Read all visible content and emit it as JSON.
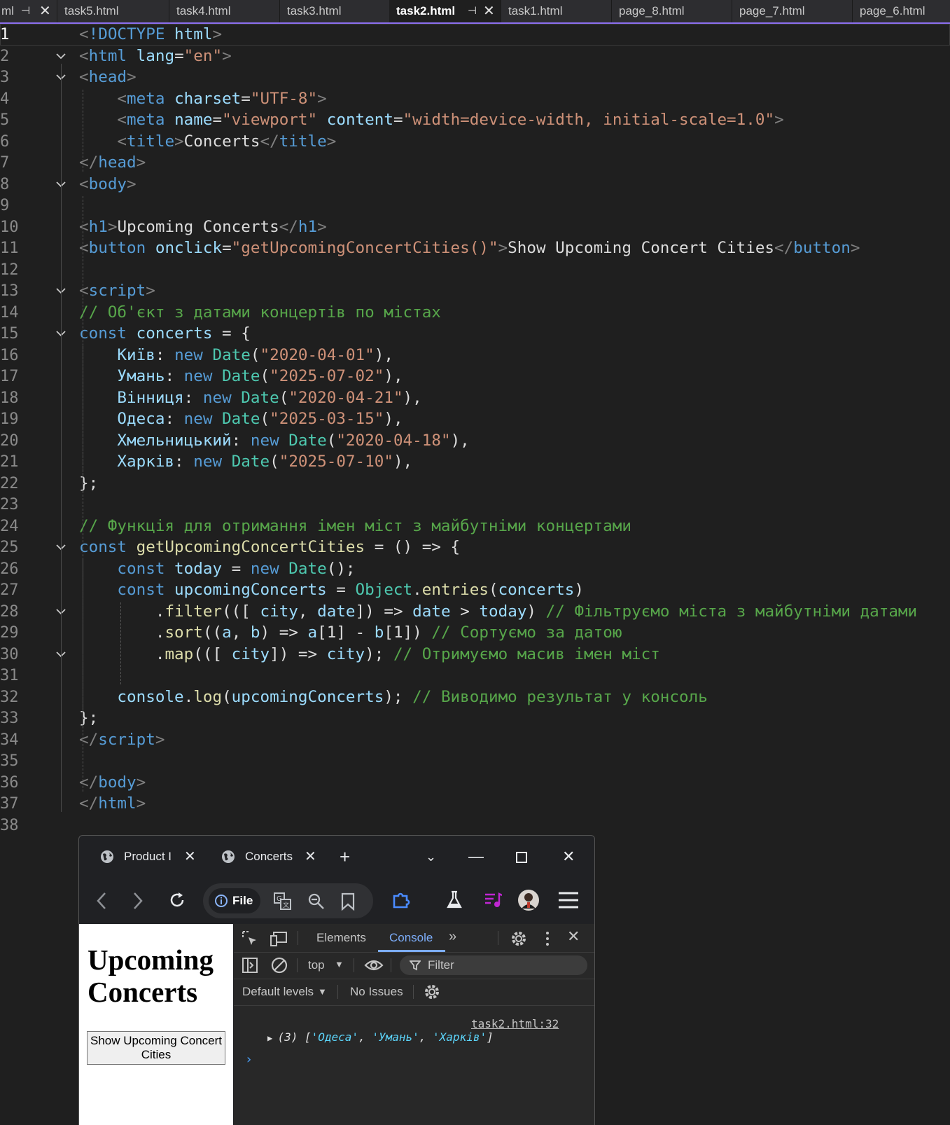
{
  "editor": {
    "tabs": [
      {
        "label": "ml",
        "active": false
      },
      {
        "label": "task5.html",
        "active": false
      },
      {
        "label": "task4.html",
        "active": false
      },
      {
        "label": "task3.html",
        "active": false
      },
      {
        "label": "task2.html",
        "active": true
      },
      {
        "label": "task1.html",
        "active": false
      },
      {
        "label": "page_8.html",
        "active": false
      },
      {
        "label": "page_7.html",
        "active": false
      },
      {
        "label": "page_6.html",
        "active": false
      }
    ],
    "lines": [
      {
        "n": "1",
        "tokens": [
          [
            "c-punc",
            "<"
          ],
          [
            "c-tag",
            "!DOCTYPE"
          ],
          [
            "c-txt",
            " "
          ],
          [
            "c-attr",
            "html"
          ],
          [
            "c-punc",
            ">"
          ]
        ]
      },
      {
        "n": "2",
        "tokens": [
          [
            "c-punc",
            "<"
          ],
          [
            "c-tag",
            "html"
          ],
          [
            "c-txt",
            " "
          ],
          [
            "c-attr",
            "lang"
          ],
          [
            "c-txt",
            "="
          ],
          [
            "c-str",
            "\"en\""
          ],
          [
            "c-punc",
            ">"
          ]
        ]
      },
      {
        "n": "3",
        "tokens": [
          [
            "c-punc",
            "<"
          ],
          [
            "c-tag",
            "head"
          ],
          [
            "c-punc",
            ">"
          ]
        ]
      },
      {
        "n": "4",
        "tokens": [
          [
            "c-txt",
            "    "
          ],
          [
            "c-punc",
            "<"
          ],
          [
            "c-tag",
            "meta"
          ],
          [
            "c-txt",
            " "
          ],
          [
            "c-attr",
            "charset"
          ],
          [
            "c-txt",
            "="
          ],
          [
            "c-str",
            "\"UTF-8\""
          ],
          [
            "c-punc",
            ">"
          ]
        ]
      },
      {
        "n": "5",
        "tokens": [
          [
            "c-txt",
            "    "
          ],
          [
            "c-punc",
            "<"
          ],
          [
            "c-tag",
            "meta"
          ],
          [
            "c-txt",
            " "
          ],
          [
            "c-attr",
            "name"
          ],
          [
            "c-txt",
            "="
          ],
          [
            "c-str",
            "\"viewport\""
          ],
          [
            "c-txt",
            " "
          ],
          [
            "c-attr",
            "content"
          ],
          [
            "c-txt",
            "="
          ],
          [
            "c-str",
            "\"width=device-width, initial-scale=1.0\""
          ],
          [
            "c-punc",
            ">"
          ]
        ]
      },
      {
        "n": "6",
        "tokens": [
          [
            "c-txt",
            "    "
          ],
          [
            "c-punc",
            "<"
          ],
          [
            "c-tag",
            "title"
          ],
          [
            "c-punc",
            ">"
          ],
          [
            "c-txt",
            "Concerts"
          ],
          [
            "c-punc",
            "</"
          ],
          [
            "c-tag",
            "title"
          ],
          [
            "c-punc",
            ">"
          ]
        ]
      },
      {
        "n": "7",
        "tokens": [
          [
            "c-punc",
            "</"
          ],
          [
            "c-tag",
            "head"
          ],
          [
            "c-punc",
            ">"
          ]
        ]
      },
      {
        "n": "8",
        "tokens": [
          [
            "c-punc",
            "<"
          ],
          [
            "c-tag",
            "body"
          ],
          [
            "c-punc",
            ">"
          ]
        ]
      },
      {
        "n": "9",
        "tokens": []
      },
      {
        "n": "10",
        "tokens": [
          [
            "c-punc",
            "<"
          ],
          [
            "c-tag",
            "h1"
          ],
          [
            "c-punc",
            ">"
          ],
          [
            "c-txt",
            "Upcoming Concerts"
          ],
          [
            "c-punc",
            "</"
          ],
          [
            "c-tag",
            "h1"
          ],
          [
            "c-punc",
            ">"
          ]
        ]
      },
      {
        "n": "11",
        "tokens": [
          [
            "c-punc",
            "<"
          ],
          [
            "c-tag",
            "button"
          ],
          [
            "c-txt",
            " "
          ],
          [
            "c-attr",
            "onclick"
          ],
          [
            "c-txt",
            "="
          ],
          [
            "c-str",
            "\"getUpcomingConcertCities()\""
          ],
          [
            "c-punc",
            ">"
          ],
          [
            "c-txt",
            "Show Upcoming Concert Cities"
          ],
          [
            "c-punc",
            "</"
          ],
          [
            "c-tag",
            "button"
          ],
          [
            "c-punc",
            ">"
          ]
        ]
      },
      {
        "n": "12",
        "tokens": []
      },
      {
        "n": "13",
        "tokens": [
          [
            "c-punc",
            "<"
          ],
          [
            "c-tag",
            "script"
          ],
          [
            "c-punc",
            ">"
          ]
        ]
      },
      {
        "n": "14",
        "tokens": [
          [
            "c-com",
            "// Об'єкт з датами концертів по містах"
          ]
        ]
      },
      {
        "n": "15",
        "tokens": [
          [
            "c-kw",
            "const"
          ],
          [
            "c-txt",
            " "
          ],
          [
            "c-var",
            "concerts"
          ],
          [
            "c-txt",
            " = {"
          ]
        ]
      },
      {
        "n": "16",
        "tokens": [
          [
            "c-txt",
            "    "
          ],
          [
            "c-var",
            "Київ"
          ],
          [
            "c-txt",
            ": "
          ],
          [
            "c-kw",
            "new"
          ],
          [
            "c-txt",
            " "
          ],
          [
            "c-type",
            "Date"
          ],
          [
            "c-txt",
            "("
          ],
          [
            "c-str",
            "\"2020-04-01\""
          ],
          [
            "c-txt",
            "),"
          ]
        ]
      },
      {
        "n": "17",
        "tokens": [
          [
            "c-txt",
            "    "
          ],
          [
            "c-var",
            "Умань"
          ],
          [
            "c-txt",
            ": "
          ],
          [
            "c-kw",
            "new"
          ],
          [
            "c-txt",
            " "
          ],
          [
            "c-type",
            "Date"
          ],
          [
            "c-txt",
            "("
          ],
          [
            "c-str",
            "\"2025-07-02\""
          ],
          [
            "c-txt",
            "),"
          ]
        ]
      },
      {
        "n": "18",
        "tokens": [
          [
            "c-txt",
            "    "
          ],
          [
            "c-var",
            "Вінниця"
          ],
          [
            "c-txt",
            ": "
          ],
          [
            "c-kw",
            "new"
          ],
          [
            "c-txt",
            " "
          ],
          [
            "c-type",
            "Date"
          ],
          [
            "c-txt",
            "("
          ],
          [
            "c-str",
            "\"2020-04-21\""
          ],
          [
            "c-txt",
            "),"
          ]
        ]
      },
      {
        "n": "19",
        "tokens": [
          [
            "c-txt",
            "    "
          ],
          [
            "c-var",
            "Одеса"
          ],
          [
            "c-txt",
            ": "
          ],
          [
            "c-kw",
            "new"
          ],
          [
            "c-txt",
            " "
          ],
          [
            "c-type",
            "Date"
          ],
          [
            "c-txt",
            "("
          ],
          [
            "c-str",
            "\"2025-03-15\""
          ],
          [
            "c-txt",
            "),"
          ]
        ]
      },
      {
        "n": "20",
        "tokens": [
          [
            "c-txt",
            "    "
          ],
          [
            "c-var",
            "Хмельницький"
          ],
          [
            "c-txt",
            ": "
          ],
          [
            "c-kw",
            "new"
          ],
          [
            "c-txt",
            " "
          ],
          [
            "c-type",
            "Date"
          ],
          [
            "c-txt",
            "("
          ],
          [
            "c-str",
            "\"2020-04-18\""
          ],
          [
            "c-txt",
            "),"
          ]
        ]
      },
      {
        "n": "21",
        "tokens": [
          [
            "c-txt",
            "    "
          ],
          [
            "c-var",
            "Харків"
          ],
          [
            "c-txt",
            ": "
          ],
          [
            "c-kw",
            "new"
          ],
          [
            "c-txt",
            " "
          ],
          [
            "c-type",
            "Date"
          ],
          [
            "c-txt",
            "("
          ],
          [
            "c-str",
            "\"2025-07-10\""
          ],
          [
            "c-txt",
            "),"
          ]
        ]
      },
      {
        "n": "22",
        "tokens": [
          [
            "c-txt",
            "};"
          ]
        ]
      },
      {
        "n": "23",
        "tokens": []
      },
      {
        "n": "24",
        "tokens": [
          [
            "c-com",
            "// Функція для отримання імен міст з майбутніми концертами"
          ]
        ]
      },
      {
        "n": "25",
        "tokens": [
          [
            "c-kw",
            "const"
          ],
          [
            "c-txt",
            " "
          ],
          [
            "c-fn",
            "getUpcomingConcertCities"
          ],
          [
            "c-txt",
            " = () => {"
          ]
        ]
      },
      {
        "n": "26",
        "tokens": [
          [
            "c-txt",
            "    "
          ],
          [
            "c-kw",
            "const"
          ],
          [
            "c-txt",
            " "
          ],
          [
            "c-var",
            "today"
          ],
          [
            "c-txt",
            " = "
          ],
          [
            "c-kw",
            "new"
          ],
          [
            "c-txt",
            " "
          ],
          [
            "c-type",
            "Date"
          ],
          [
            "c-txt",
            "();"
          ]
        ]
      },
      {
        "n": "27",
        "tokens": [
          [
            "c-txt",
            "    "
          ],
          [
            "c-kw",
            "const"
          ],
          [
            "c-txt",
            " "
          ],
          [
            "c-var",
            "upcomingConcerts"
          ],
          [
            "c-txt",
            " = "
          ],
          [
            "c-cls",
            "Object"
          ],
          [
            "c-txt",
            "."
          ],
          [
            "c-fn",
            "entries"
          ],
          [
            "c-txt",
            "("
          ],
          [
            "c-var",
            "concerts"
          ],
          [
            "c-txt",
            ")"
          ]
        ]
      },
      {
        "n": "28",
        "tokens": [
          [
            "c-txt",
            "        ."
          ],
          [
            "c-fn",
            "filter"
          ],
          [
            "c-txt",
            "(([ "
          ],
          [
            "c-var",
            "city"
          ],
          [
            "c-txt",
            ", "
          ],
          [
            "c-var",
            "date"
          ],
          [
            "c-txt",
            "]) => "
          ],
          [
            "c-var",
            "date"
          ],
          [
            "c-txt",
            " > "
          ],
          [
            "c-var",
            "today"
          ],
          [
            "c-txt",
            ") "
          ],
          [
            "c-com",
            "// Фільтруємо міста з майбутніми датами"
          ]
        ]
      },
      {
        "n": "29",
        "tokens": [
          [
            "c-txt",
            "        ."
          ],
          [
            "c-fn",
            "sort"
          ],
          [
            "c-txt",
            "(("
          ],
          [
            "c-var",
            "a"
          ],
          [
            "c-txt",
            ", "
          ],
          [
            "c-var",
            "b"
          ],
          [
            "c-txt",
            ") => "
          ],
          [
            "c-var",
            "a"
          ],
          [
            "c-txt",
            "[1] - "
          ],
          [
            "c-var",
            "b"
          ],
          [
            "c-txt",
            "[1]) "
          ],
          [
            "c-com",
            "// Сортуємо за датою"
          ]
        ]
      },
      {
        "n": "30",
        "tokens": [
          [
            "c-txt",
            "        ."
          ],
          [
            "c-fn",
            "map"
          ],
          [
            "c-txt",
            "(([ "
          ],
          [
            "c-var",
            "city"
          ],
          [
            "c-txt",
            "]) => "
          ],
          [
            "c-var",
            "city"
          ],
          [
            "c-txt",
            "); "
          ],
          [
            "c-com",
            "// Отримуємо масив імен міст"
          ]
        ]
      },
      {
        "n": "31",
        "tokens": []
      },
      {
        "n": "32",
        "tokens": [
          [
            "c-txt",
            "    "
          ],
          [
            "c-var",
            "console"
          ],
          [
            "c-txt",
            "."
          ],
          [
            "c-fn",
            "log"
          ],
          [
            "c-txt",
            "("
          ],
          [
            "c-var",
            "upcomingConcerts"
          ],
          [
            "c-txt",
            "); "
          ],
          [
            "c-com",
            "// Виводимо результат у консоль"
          ]
        ]
      },
      {
        "n": "33",
        "tokens": [
          [
            "c-txt",
            "};"
          ]
        ]
      },
      {
        "n": "34",
        "tokens": [
          [
            "c-punc",
            "</"
          ],
          [
            "c-tag",
            "script"
          ],
          [
            "c-punc",
            ">"
          ]
        ]
      },
      {
        "n": "35",
        "tokens": []
      },
      {
        "n": "36",
        "tokens": [
          [
            "c-punc",
            "</"
          ],
          [
            "c-tag",
            "body"
          ],
          [
            "c-punc",
            ">"
          ]
        ]
      },
      {
        "n": "37",
        "tokens": [
          [
            "c-punc",
            "</"
          ],
          [
            "c-tag",
            "html"
          ],
          [
            "c-punc",
            ">"
          ]
        ]
      },
      {
        "n": "38",
        "tokens": []
      }
    ]
  },
  "browser": {
    "tabs": [
      {
        "label": "Product I"
      },
      {
        "label": "Concerts"
      }
    ],
    "address_chip": "File",
    "page": {
      "heading": "Upcoming Concerts",
      "button_label": "Show Upcoming Concert Cities"
    },
    "devtools": {
      "tab_elements": "Elements",
      "tab_console": "Console",
      "context": "top",
      "filter_placeholder": "Filter",
      "levels": "Default levels",
      "issues": "No Issues",
      "log_source": "task2.html:32",
      "log_count": "(3)",
      "log_items": [
        "'Одеса'",
        "'Умань'",
        "'Харків'"
      ]
    }
  },
  "colors": {
    "accent": "#8c6ff0",
    "tag": "#569cd6",
    "string": "#ce9178",
    "comment": "#57a64a"
  }
}
